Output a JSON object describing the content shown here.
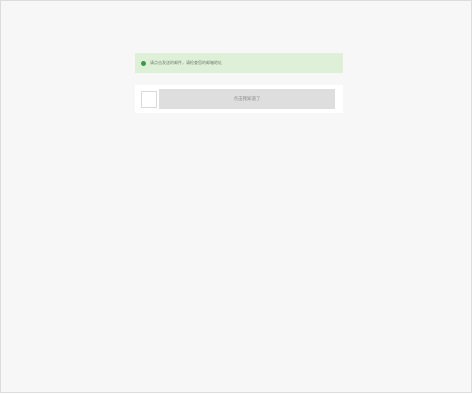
{
  "notice": {
    "text": "请点击发送的邮件，请检查您的邮箱地址",
    "icon": "success-dot-icon"
  },
  "actions": {
    "agree_label": "点击我知道了"
  }
}
